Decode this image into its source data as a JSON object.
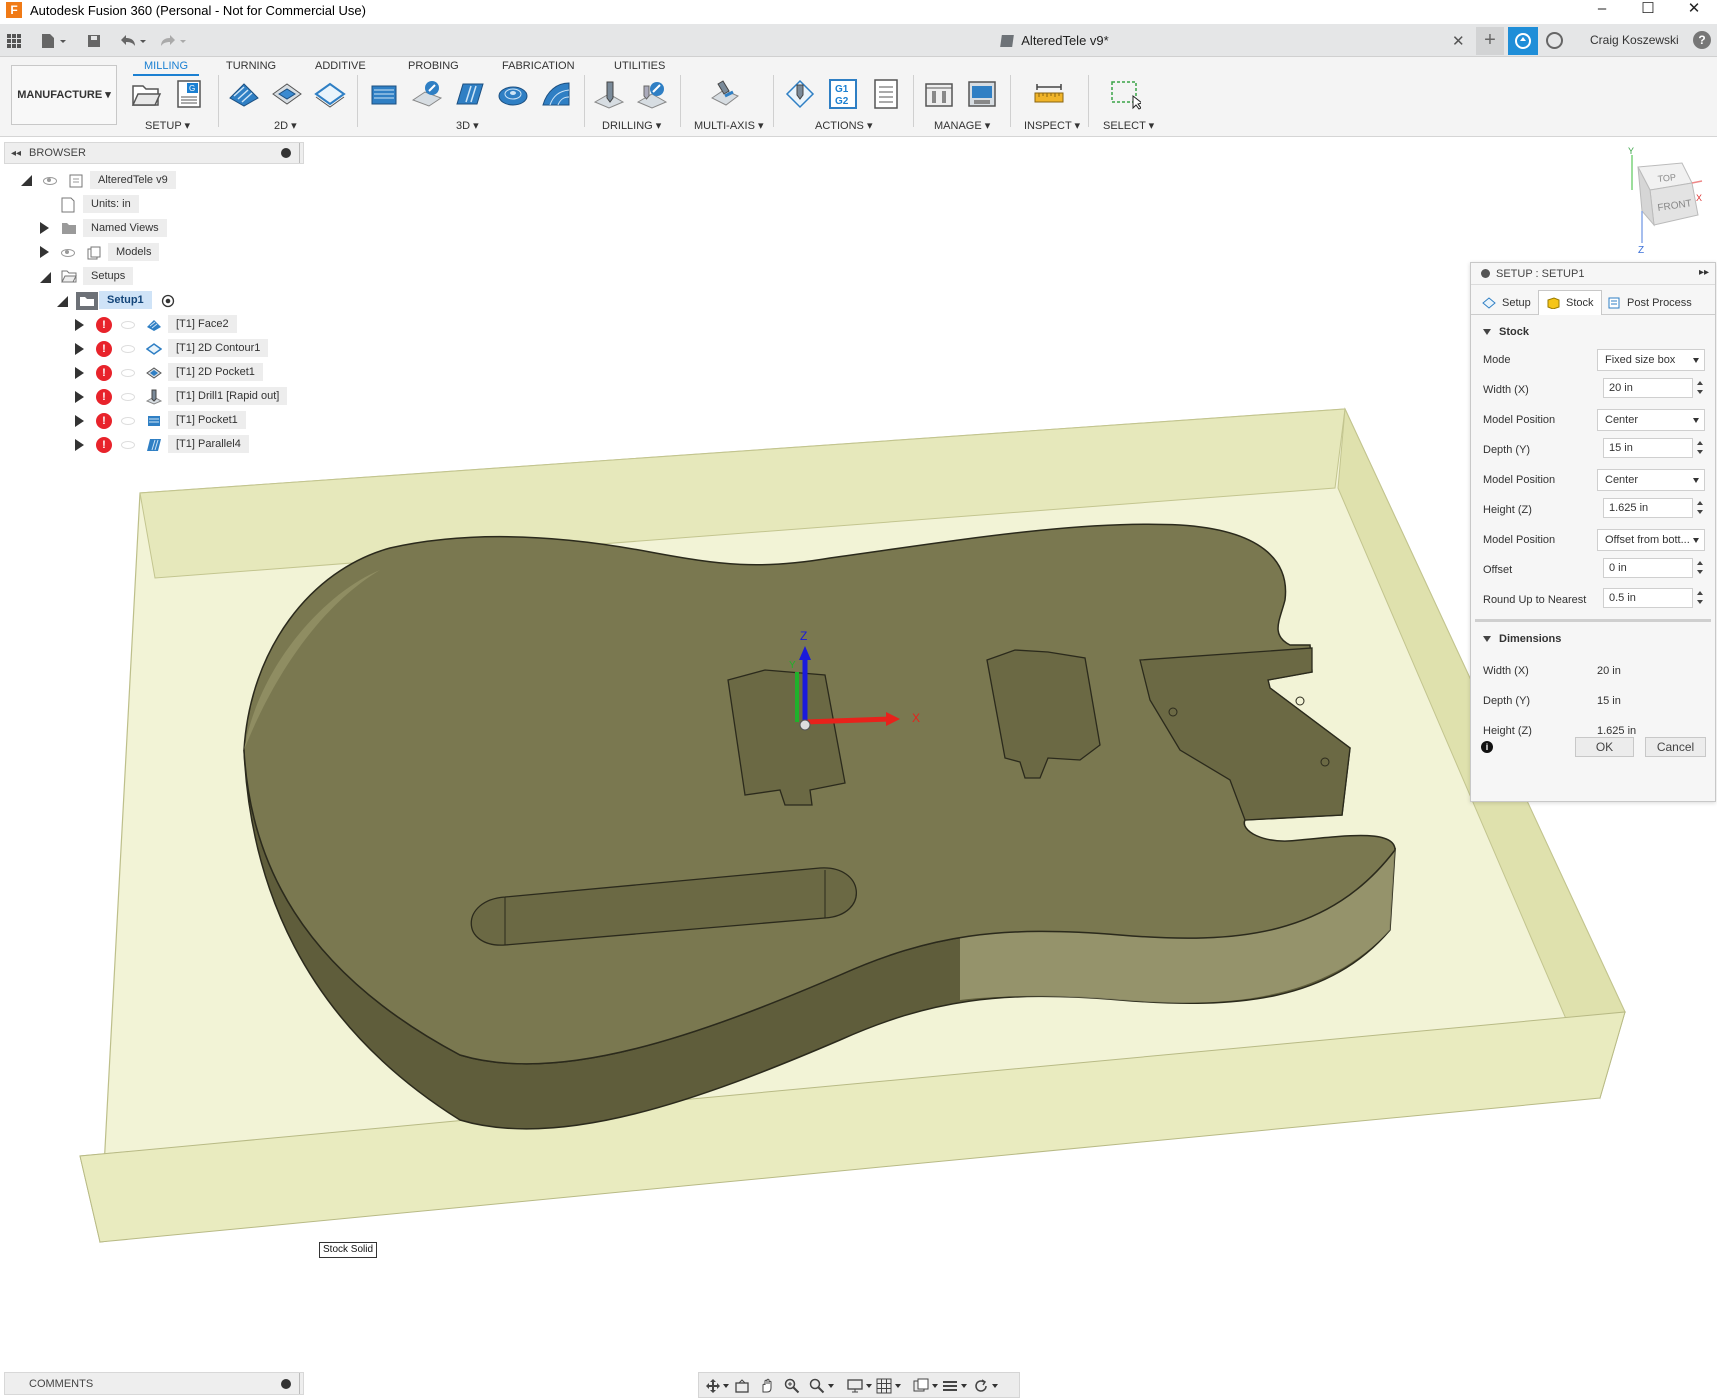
{
  "app": {
    "window_title": "Autodesk Fusion 360 (Personal - Not for Commercial Use)",
    "logo_letter": "F",
    "win_minimize": "–",
    "win_maximize": "☐",
    "win_close": "✕"
  },
  "quickbar": {
    "document_tab": "AlteredTele v9*",
    "close": "✕",
    "new_tab": "+",
    "user": "Craig Koszewski",
    "help": "?"
  },
  "ribbon": {
    "workspace": "MANUFACTURE ▾",
    "tabs": [
      "MILLING",
      "TURNING",
      "ADDITIVE",
      "PROBING",
      "FABRICATION",
      "UTILITIES"
    ],
    "groups": {
      "setup": "SETUP ▾",
      "two_d": "2D ▾",
      "three_d": "3D ▾",
      "drilling": "DRILLING ▾",
      "multi_axis": "MULTI-AXIS ▾",
      "actions": "ACTIONS ▾",
      "manage": "MANAGE ▾",
      "inspect": "INSPECT ▾",
      "select": "SELECT ▾"
    },
    "actions_gcode": "G1 G2"
  },
  "browser": {
    "title": "BROWSER",
    "collapse": "◂◂",
    "root": "AlteredTele v9",
    "units": "Units: in",
    "named_views": "Named Views",
    "models": "Models",
    "setups": "Setups",
    "setup1": "Setup1",
    "operations": [
      "[T1] Face2",
      "[T1] 2D Contour1",
      "[T1] 2D Pocket1",
      "[T1] Drill1 [Rapid out]",
      "[T1] Pocket1",
      "[T1] Parallel4"
    ],
    "error_glyph": "!"
  },
  "viewport": {
    "axis_z": "Z",
    "axis_x": "X",
    "axis_y": "Y",
    "stock_tooltip": "Stock Solid",
    "colors": {
      "stock": "#eceec4",
      "body": "#7a7850",
      "body_dark": "#5e5c3a",
      "edge": "#2b2a1c"
    }
  },
  "viewcube": {
    "top": "TOP",
    "front": "FRONT",
    "axis_y": "Y",
    "axis_x": "X",
    "axis_z": "Z"
  },
  "dialog": {
    "title": "SETUP : SETUP1",
    "expand": "▸▸",
    "tabs": [
      "Setup",
      "Stock",
      "Post Process"
    ],
    "active_tab": "Stock",
    "stock_section": "Stock",
    "fields": [
      {
        "label": "Mode",
        "value": "Fixed size box",
        "kind": "select"
      },
      {
        "label": "Width (X)",
        "value": "20 in",
        "kind": "number"
      },
      {
        "label": "Model Position",
        "value": "Center",
        "kind": "select"
      },
      {
        "label": "Depth (Y)",
        "value": "15 in",
        "kind": "number"
      },
      {
        "label": "Model Position",
        "value": "Center",
        "kind": "select"
      },
      {
        "label": "Height (Z)",
        "value": "1.625 in",
        "kind": "number"
      },
      {
        "label": "Model Position",
        "value": "Offset from bott...",
        "kind": "select"
      },
      {
        "label": "Offset",
        "value": "0 in",
        "kind": "number"
      },
      {
        "label": "Round Up to Nearest",
        "value": "0.5 in",
        "kind": "number"
      }
    ],
    "dimensions_section": "Dimensions",
    "dimensions": [
      {
        "label": "Width (X)",
        "value": "20 in"
      },
      {
        "label": "Depth (Y)",
        "value": "15 in"
      },
      {
        "label": "Height (Z)",
        "value": "1.625 in"
      }
    ],
    "ok": "OK",
    "cancel": "Cancel",
    "info": "i"
  },
  "comments": {
    "title": "COMMENTS"
  }
}
